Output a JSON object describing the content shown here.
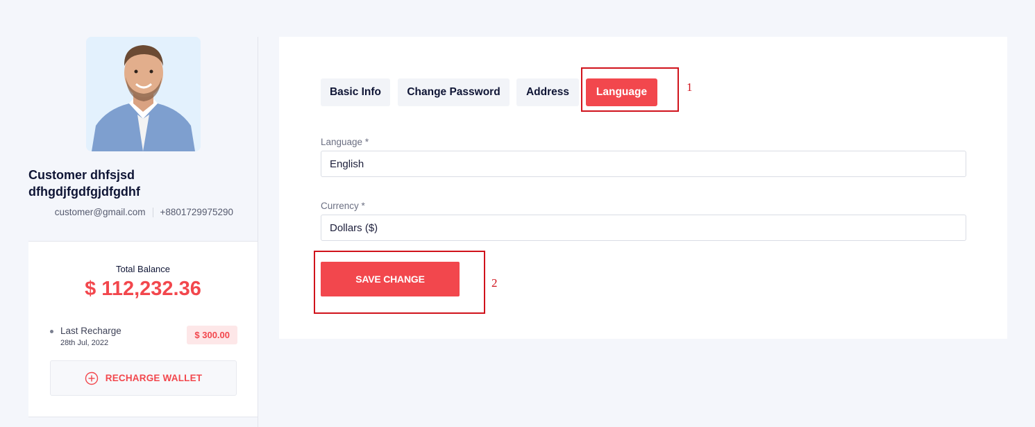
{
  "profile": {
    "name": "Customer dhfsjsd dfhgdjfgdfgjdfgdhf",
    "email": "customer@gmail.com",
    "phone": "+8801729975290"
  },
  "wallet": {
    "balance_label": "Total Balance",
    "balance_amount": "$ 112,232.36",
    "last_recharge_label": "Last Recharge",
    "last_recharge_date": "28th Jul, 2022",
    "last_recharge_amount": "$ 300.00",
    "recharge_button": "RECHARGE WALLET"
  },
  "tabs": [
    {
      "label": "Basic Info",
      "active": false
    },
    {
      "label": "Change Password",
      "active": false
    },
    {
      "label": "Address",
      "active": false
    },
    {
      "label": "Language",
      "active": true
    }
  ],
  "form": {
    "language_label": "Language *",
    "language_value": "English",
    "currency_label": "Currency *",
    "currency_value": "Dollars ($)",
    "save_button": "SAVE CHANGE"
  },
  "annotations": {
    "first": "1",
    "second": "2"
  },
  "colors": {
    "accent": "#f2474d",
    "annotation": "#d0121b",
    "background": "#f4f6fb"
  }
}
